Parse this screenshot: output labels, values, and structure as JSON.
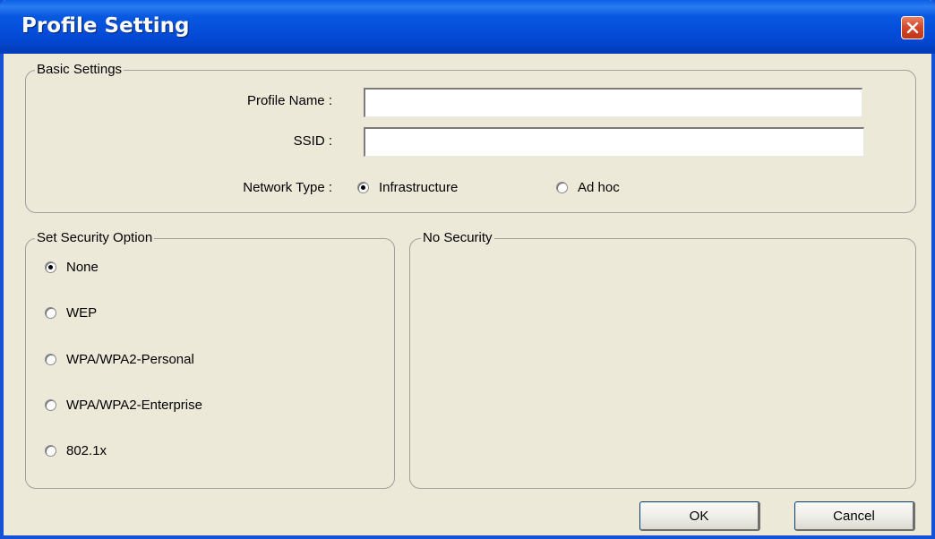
{
  "window": {
    "title": "Profile Setting",
    "colors": {
      "titlebar": "#0349d6",
      "background": "#ece9d8",
      "close": "#d2462a"
    }
  },
  "basic_settings": {
    "title": "Basic Settings",
    "profile_name_label": "Profile Name :",
    "profile_name_value": "",
    "ssid_label": "SSID :",
    "ssid_value": "",
    "network_type_label": "Network Type :",
    "network_types": [
      {
        "label": "Infrastructure",
        "checked": true
      },
      {
        "label": "Ad hoc",
        "checked": false
      }
    ]
  },
  "security_option": {
    "title": "Set Security Option",
    "options": [
      {
        "label": "None",
        "checked": true
      },
      {
        "label": "WEP",
        "checked": false
      },
      {
        "label": "WPA/WPA2-Personal",
        "checked": false
      },
      {
        "label": "WPA/WPA2-Enterprise",
        "checked": false
      },
      {
        "label": "802.1x",
        "checked": false
      }
    ]
  },
  "security_detail": {
    "title": "No Security"
  },
  "buttons": {
    "ok": "OK",
    "cancel": "Cancel"
  }
}
